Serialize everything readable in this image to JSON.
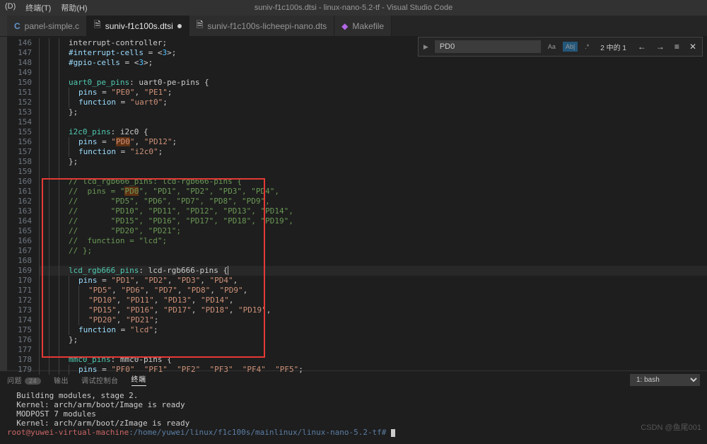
{
  "title": "suniv-f1c100s.dtsi - linux-nano-5.2-tf - Visual Studio Code",
  "menu": {
    "d": "(D)",
    "terminal": "终端(T)",
    "help": "帮助(H)"
  },
  "tabs": [
    {
      "icon": "C",
      "label": "panel-simple.c",
      "modified": false,
      "active": false
    },
    {
      "icon": "file",
      "label": "suniv-f1c100s.dtsi",
      "modified": true,
      "active": true
    },
    {
      "icon": "file",
      "label": "suniv-f1c100s-licheepi-nano.dts",
      "modified": false,
      "active": false
    },
    {
      "icon": "make",
      "label": "Makefile",
      "modified": false,
      "active": false
    }
  ],
  "find": {
    "value": "PD0",
    "match_case": "Aa",
    "whole_word": "Ab|",
    "regex": ".*",
    "count": "2 中的 1"
  },
  "line_start": 146,
  "line_end": 179,
  "code": [
    {
      "html": "<span class='c-punct'>interrupt-controller;</span>",
      "indent": 3
    },
    {
      "html": "<span class='c-prop'>#interrupt-cells</span> <span class='c-punct'>= &lt;</span><span class='c-key'>3</span><span class='c-punct'>&gt;;</span>",
      "indent": 3
    },
    {
      "html": "<span class='c-prop'>#gpio-cells</span> <span class='c-punct'>= &lt;</span><span class='c-key'>3</span><span class='c-punct'>&gt;;</span>",
      "indent": 3
    },
    {
      "html": "",
      "indent": 3
    },
    {
      "html": "<span class='c-id'>uart0_pe_pins</span><span class='c-punct'>:</span> <span class='c-punct'>uart0-pe-pins {</span>",
      "indent": 3
    },
    {
      "html": "<span class='c-prop'>pins</span> <span class='c-punct'>= </span><span class='c-str'>\"PE0\"</span><span class='c-punct'>, </span><span class='c-str'>\"PE1\"</span><span class='c-punct'>;</span>",
      "indent": 4
    },
    {
      "html": "<span class='c-prop'>function</span> <span class='c-punct'>= </span><span class='c-str'>\"uart0\"</span><span class='c-punct'>;</span>",
      "indent": 4
    },
    {
      "html": "<span class='c-punct'>};</span>",
      "indent": 3
    },
    {
      "html": "",
      "indent": 3
    },
    {
      "html": "<span class='c-id'>i2c0_pins</span><span class='c-punct'>:</span> <span class='c-punct'>i2c0 {</span>",
      "indent": 3
    },
    {
      "html": "<span class='c-prop'>pins</span> <span class='c-punct'>= </span><span class='c-str'>\"<span class='c-hl'>PD0</span>\"</span><span class='c-punct'>, </span><span class='c-str'>\"PD12\"</span><span class='c-punct'>;</span>",
      "indent": 4
    },
    {
      "html": "<span class='c-prop'>function</span> <span class='c-punct'>= </span><span class='c-str'>\"i2c0\"</span><span class='c-punct'>;</span>",
      "indent": 4
    },
    {
      "html": "<span class='c-punct'>};</span>",
      "indent": 3
    },
    {
      "html": "",
      "indent": 3
    },
    {
      "html": "<span class='c-cmt'>// lcd_rgb666_pins: lcd-rgb666-pins {</span>",
      "indent": 3
    },
    {
      "html": "<span class='c-cmt'>//  pins = \"<span class='c-hl'>PD0</span>\", \"PD1\", \"PD2\", \"PD3\", \"PD4\",</span>",
      "indent": 3
    },
    {
      "html": "<span class='c-cmt'>//       \"PD5\", \"PD6\", \"PD7\", \"PD8\", \"PD9\",</span>",
      "indent": 3
    },
    {
      "html": "<span class='c-cmt'>//       \"PD10\", \"PD11\", \"PD12\", \"PD13\", \"PD14\",</span>",
      "indent": 3
    },
    {
      "html": "<span class='c-cmt'>//       \"PD15\", \"PD16\", \"PD17\", \"PD18\", \"PD19\",</span>",
      "indent": 3
    },
    {
      "html": "<span class='c-cmt'>//       \"PD20\", \"PD21\";</span>",
      "indent": 3
    },
    {
      "html": "<span class='c-cmt'>//  function = \"lcd\";</span>",
      "indent": 3
    },
    {
      "html": "<span class='c-cmt'>// };</span>",
      "indent": 3
    },
    {
      "html": "",
      "indent": 3
    },
    {
      "html": "<span class='c-id'>lcd_rgb666_pins</span><span class='c-punct'>:</span> <span class='c-punct'>lcd-rgb666-pins {</span><span class='c-cur'></span>",
      "indent": 3,
      "active": true
    },
    {
      "html": "<span class='c-prop'>pins</span> <span class='c-punct'>= </span><span class='c-str'>\"PD1\"</span><span class='c-punct'>, </span><span class='c-str'>\"PD2\"</span><span class='c-punct'>, </span><span class='c-str'>\"PD3\"</span><span class='c-punct'>, </span><span class='c-str'>\"PD4\"</span><span class='c-punct'>,</span>",
      "indent": 4
    },
    {
      "html": "<span class='c-str'>\"PD5\"</span><span class='c-punct'>, </span><span class='c-str'>\"PD6\"</span><span class='c-punct'>, </span><span class='c-str'>\"PD7\"</span><span class='c-punct'>, </span><span class='c-str'>\"PD8\"</span><span class='c-punct'>, </span><span class='c-str'>\"PD9\"</span><span class='c-punct'>,</span>",
      "indent": 5
    },
    {
      "html": "<span class='c-str'>\"PD10\"</span><span class='c-punct'>, </span><span class='c-str'>\"PD11\"</span><span class='c-punct'>, </span><span class='c-str'>\"PD13\"</span><span class='c-punct'>, </span><span class='c-str'>\"PD14\"</span><span class='c-punct'>,</span>",
      "indent": 5
    },
    {
      "html": "<span class='c-str'>\"PD15\"</span><span class='c-punct'>, </span><span class='c-str'>\"PD16\"</span><span class='c-punct'>, </span><span class='c-str'>\"PD17\"</span><span class='c-punct'>, </span><span class='c-str'>\"PD18\"</span><span class='c-punct'>, </span><span class='c-str'>\"PD19\"</span><span class='c-punct'>,</span>",
      "indent": 5
    },
    {
      "html": "<span class='c-str'>\"PD20\"</span><span class='c-punct'>, </span><span class='c-str'>\"PD21\"</span><span class='c-punct'>;</span>",
      "indent": 5
    },
    {
      "html": "<span class='c-prop'>function</span> <span class='c-punct'>= </span><span class='c-str'>\"lcd\"</span><span class='c-punct'>;</span>",
      "indent": 4
    },
    {
      "html": "<span class='c-punct'>};</span>",
      "indent": 3
    },
    {
      "html": "",
      "indent": 3
    },
    {
      "html": "<span class='c-id'>mmc0_pins</span><span class='c-punct'>:</span> <span class='c-punct'>mmc0-pins {</span>",
      "indent": 3
    },
    {
      "html": "<span class='c-prop'>pins</span> <span class='c-punct'>= </span><span class='c-str'>\"PF0\"  \"PF1\"  \"PF2\"  \"PF3\"  \"PF4\"  \"PF5\"</span><span class='c-punct'>;</span>",
      "indent": 4
    }
  ],
  "panel": {
    "tabs": {
      "problems": "问题",
      "output": "输出",
      "debug": "调试控制台",
      "terminal": "终端"
    },
    "problems_count": "24",
    "shell": "1: bash"
  },
  "terminal_lines": [
    "  Building modules, stage 2.",
    "  Kernel: arch/arm/boot/Image is ready",
    "  MODPOST 7 modules",
    "  Kernel: arch/arm/boot/zImage is ready"
  ],
  "terminal_prompt": {
    "user": "root@yuwei-virtual-machine",
    "path": ":/home/yuwei/linux/f1c100s/mainlinux/linux-nano-5.2-tf#"
  },
  "watermark": "CSDN @鱼尾001"
}
